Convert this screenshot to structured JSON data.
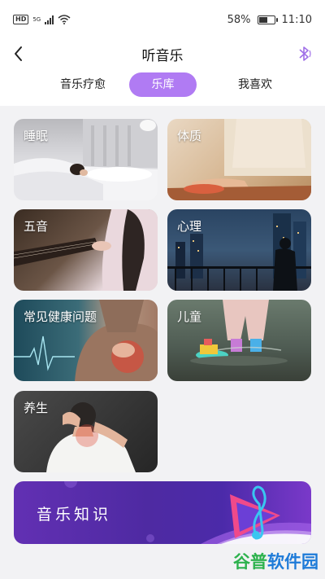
{
  "status_bar": {
    "hd": "HD",
    "network": "5G",
    "battery_percent": "58%",
    "battery_level": 0.58,
    "time": "11:10"
  },
  "header": {
    "title": "听音乐",
    "back_icon": "chevron-left-icon",
    "bluetooth_icon": "bluetooth-icon",
    "accent_color": "#b07bf3"
  },
  "tabs": [
    {
      "label": "音乐疗愈",
      "active": false
    },
    {
      "label": "乐库",
      "active": true
    },
    {
      "label": "我喜欢",
      "active": false
    }
  ],
  "categories": [
    {
      "label": "睡眠"
    },
    {
      "label": "体质"
    },
    {
      "label": "五音"
    },
    {
      "label": "心理"
    },
    {
      "label": "常见健康问题"
    },
    {
      "label": "儿童"
    },
    {
      "label": "养生"
    }
  ],
  "banner": {
    "label": "音乐知识",
    "icon": "music-note-play-icon"
  },
  "watermark": {
    "part1": "谷普",
    "part2": "软件园"
  }
}
